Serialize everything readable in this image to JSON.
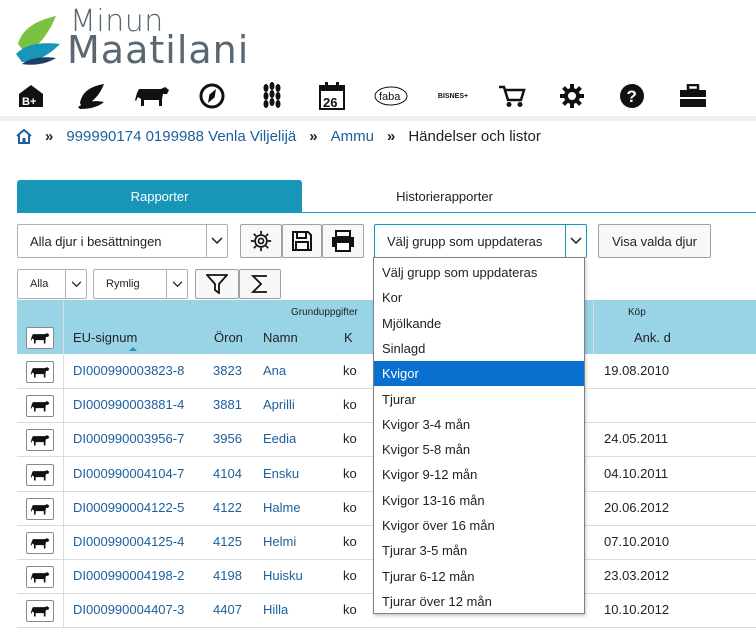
{
  "brand": {
    "line1": "Minun",
    "line2": "Maatilani",
    "leaf_colors": [
      "#7cc242",
      "#1796b9",
      "#1c3f66"
    ]
  },
  "nav": [
    {
      "name": "b-plus-icon",
      "label": "B+"
    },
    {
      "name": "leaf-icon"
    },
    {
      "name": "cow-icon"
    },
    {
      "name": "compass-icon"
    },
    {
      "name": "wheat-icon"
    },
    {
      "name": "calendar-icon",
      "label": "26"
    },
    {
      "name": "faba-icon",
      "label": "faba"
    },
    {
      "name": "bisnes-icon",
      "label": "BISNES+"
    },
    {
      "name": "cart-icon"
    },
    {
      "name": "gear-icon"
    },
    {
      "name": "help-icon"
    },
    {
      "name": "briefcase-icon"
    }
  ],
  "breadcrumb": {
    "farm": "999990174 0199988 Venla Viljelijä",
    "section": "Ammu",
    "current": "Händelser och listor",
    "sep": "»"
  },
  "tabs": {
    "active": "Rapporter",
    "other": "Historierapporter"
  },
  "controls": {
    "animals_select": "Alla djur i besättningen",
    "group_select": "Välj grupp som uppdateras",
    "show_selected": "Visa valda djur",
    "filter_all": "Alla",
    "density": "Rymlig"
  },
  "table": {
    "group_basic": "Grunduppgifter",
    "group_purchase": "Köp",
    "columns": {
      "eu": "EU-signum",
      "ear": "Öron",
      "name": "Namn",
      "sex": "K",
      "arrival": "Ank. d"
    },
    "rows": [
      {
        "eu": "DI000990003823-8",
        "ear": "3823",
        "name": "Ana",
        "sex": "ko",
        "arrival": "19.08.2010"
      },
      {
        "eu": "DI000990003881-4",
        "ear": "3881",
        "name": "Aprilli",
        "sex": "ko",
        "arrival": ""
      },
      {
        "eu": "DI000990003956-7",
        "ear": "3956",
        "name": "Eedia",
        "sex": "ko",
        "arrival": "24.05.2011"
      },
      {
        "eu": "DI000990004104-7",
        "ear": "4104",
        "name": "Ensku",
        "sex": "ko",
        "arrival": "04.10.2011"
      },
      {
        "eu": "DI000990004122-5",
        "ear": "4122",
        "name": "Halme",
        "sex": "ko",
        "arrival": "20.06.2012"
      },
      {
        "eu": "DI000990004125-4",
        "ear": "4125",
        "name": "Helmi",
        "sex": "ko",
        "arrival": "07.10.2010"
      },
      {
        "eu": "DI000990004198-2",
        "ear": "4198",
        "name": "Huisku",
        "sex": "ko",
        "arrival": "23.03.2012"
      },
      {
        "eu": "DI000990004407-3",
        "ear": "4407",
        "name": "Hilla",
        "sex": "ko",
        "arrival": "10.10.2012"
      }
    ]
  },
  "dropdown": {
    "selected": "Kvigor",
    "options": [
      "Välj grupp som uppdateras",
      "Kor",
      "Mjölkande",
      "Sinlagd",
      "Kvigor",
      "Tjurar",
      "Kvigor 3-4 mån",
      "Kvigor 5-8 mån",
      "Kvigor 9-12 mån",
      "Kvigor 13-16 mån",
      "Kvigor över 16 mån",
      "Tjurar 3-5 mån",
      "Tjurar 6-12 mån",
      "Tjurar över 12 mån"
    ]
  },
  "colors": {
    "accent": "#1796b9",
    "header_bg": "#99d3e6",
    "link": "#1a5f9e",
    "selected": "#0a70d0"
  }
}
